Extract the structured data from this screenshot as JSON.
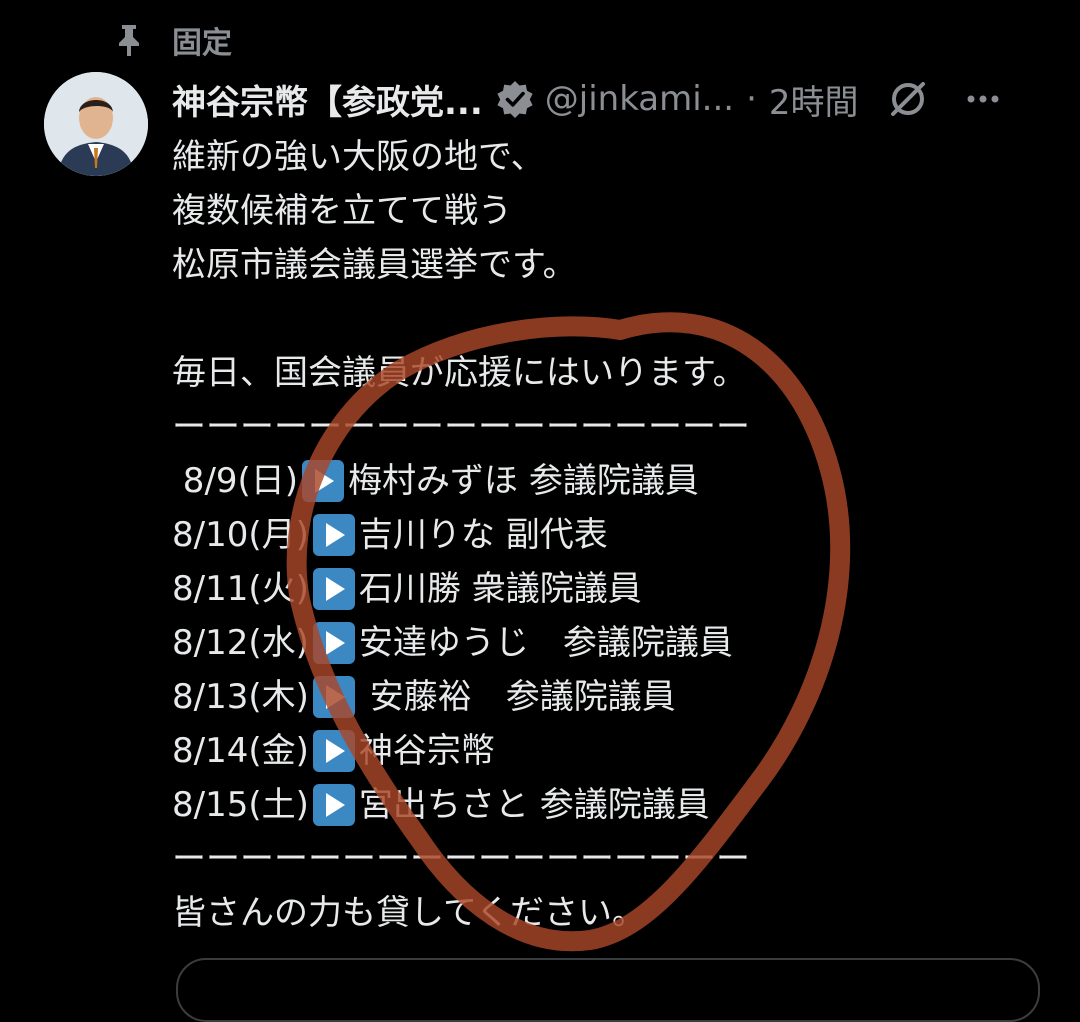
{
  "pinned": {
    "label": "固定",
    "icon": "pin-icon"
  },
  "author": {
    "name": "神谷宗幣【参政党...",
    "handle": "@jinkami...",
    "separator": "·",
    "timestamp": "2時間",
    "verified_color": "#8b8f94"
  },
  "tweet": {
    "lines": [
      "維新の強い大阪の地で、",
      "複数候補を立てて戦う",
      "松原市議会議員選挙です。",
      "",
      "毎日、国会議員が応援にはいります。",
      "ーーーーーーーーーーーーーーーーー",
      {
        "date": " 8/9(日)",
        "text": "梅村みずほ 参議院議員"
      },
      {
        "date": "8/10(月)",
        "text": "吉川りな 副代表"
      },
      {
        "date": "8/11(火)",
        "text": "石川勝 衆議院議員"
      },
      {
        "date": "8/12(水)",
        "text": "安達ゆうじ　参議院議員"
      },
      {
        "date": "8/13(木)",
        "text": " 安藤裕　参議院議員"
      },
      {
        "date": "8/14(金)",
        "text": "神谷宗幣"
      },
      {
        "date": "8/15(土)",
        "text": "宮出ちさと 参議院議員"
      },
      "ーーーーーーーーーーーーーーーーー",
      "皆さんの力も貸してください。"
    ],
    "play_emoji_color": "#3b88c3"
  },
  "annotation": {
    "color": "#a9472a"
  },
  "icons": {
    "verified": "verified-badge-icon",
    "grok": "grok-icon",
    "more": "more-options-icon",
    "avatar": "avatar"
  }
}
